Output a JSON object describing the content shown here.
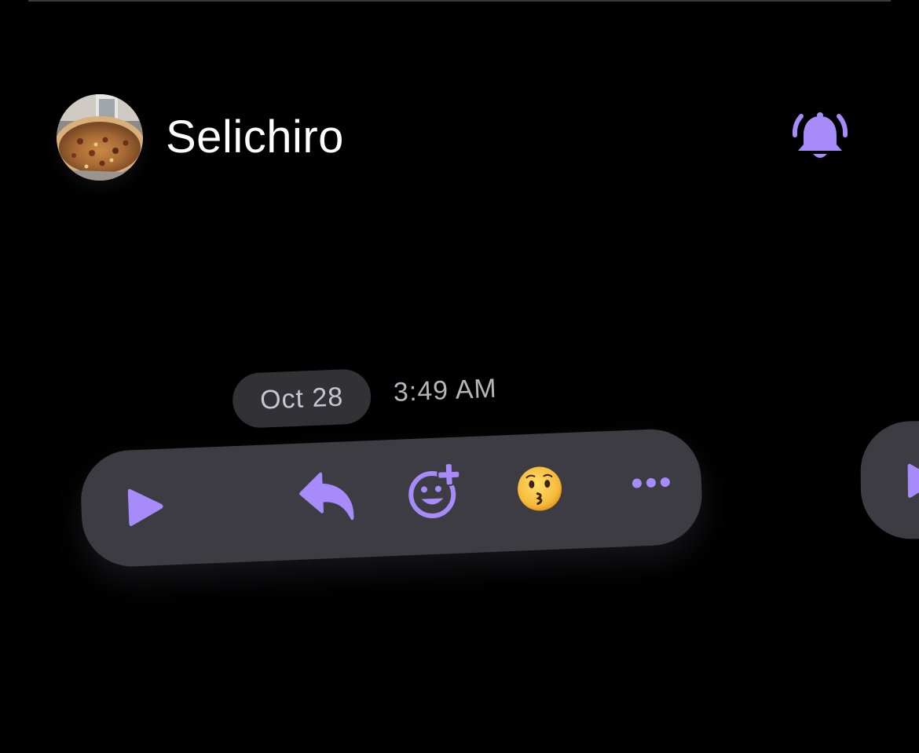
{
  "header": {
    "contact_name": "Selichiro",
    "avatar_icon": "pizza-photo",
    "bell_icon": "bell-ringing-icon"
  },
  "message": {
    "date": "Oct 28",
    "time": "3:49 AM",
    "reaction_emoji": "😗"
  },
  "action_bar": {
    "icons": [
      "play-icon",
      "reply-icon",
      "add-reaction-icon",
      "kissing-face-emoji",
      "more-icon"
    ]
  },
  "colors": {
    "background": "#000000",
    "accent": "#a78bfa",
    "bar_background": "#3d3c42",
    "pill_background": "#323136",
    "text_primary": "#ffffff",
    "text_secondary": "#b6b5bb"
  }
}
